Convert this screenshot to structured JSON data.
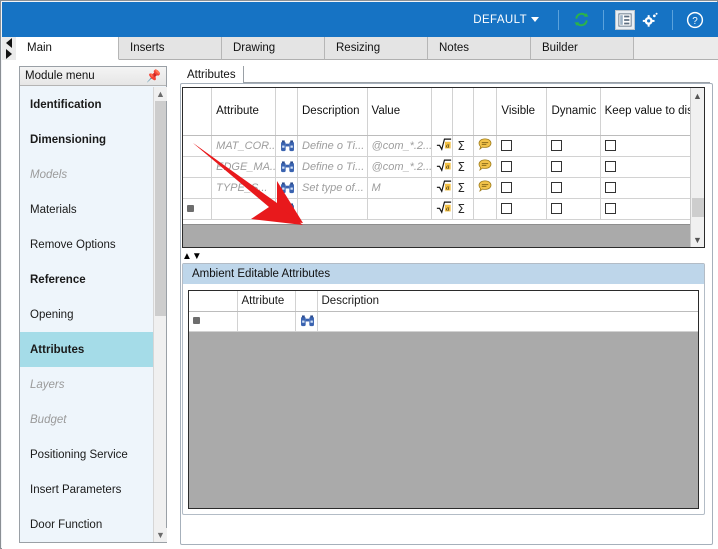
{
  "titlebar": {
    "profile_label": "DEFAULT",
    "caret_icon": "chevron-down-icon",
    "buttons": [
      {
        "name": "refresh-icon",
        "glyph": "↻"
      },
      {
        "name": "list-view-icon",
        "glyph": "▤"
      },
      {
        "name": "settings-gear-icon",
        "glyph": "⚙"
      },
      {
        "name": "help-icon",
        "glyph": "?"
      }
    ]
  },
  "tabs": [
    {
      "label": "Main",
      "active": true
    },
    {
      "label": "Inserts",
      "active": false
    },
    {
      "label": "Drawing",
      "active": false
    },
    {
      "label": "Resizing",
      "active": false
    },
    {
      "label": "Notes",
      "active": false
    },
    {
      "label": "Builder",
      "active": false
    }
  ],
  "sidebar": {
    "title": "Module menu",
    "pin_icon": "pin-icon",
    "items": [
      {
        "label": "Identification",
        "style": "bold"
      },
      {
        "label": "Dimensioning",
        "style": "bold"
      },
      {
        "label": "Models",
        "style": "dim"
      },
      {
        "label": "Materials",
        "style": "normal"
      },
      {
        "label": "Remove Options",
        "style": "normal"
      },
      {
        "label": "Reference",
        "style": "bold"
      },
      {
        "label": "Opening",
        "style": "normal"
      },
      {
        "label": "Attributes",
        "style": "selected"
      },
      {
        "label": "Layers",
        "style": "dim"
      },
      {
        "label": "Budget",
        "style": "dim"
      },
      {
        "label": "Positioning Service",
        "style": "normal"
      },
      {
        "label": "Insert Parameters",
        "style": "normal"
      },
      {
        "label": "Door Function",
        "style": "normal"
      }
    ],
    "scroll_up_icon": "chevron-up-icon",
    "scroll_down_icon": "chevron-down-icon"
  },
  "content": {
    "inner_tabs": [
      {
        "label": "Attributes"
      }
    ],
    "upper_grid": {
      "columns": [
        "",
        "Attribute",
        "",
        "Description",
        "Value",
        "",
        "",
        "",
        "Visible",
        "Dynamic",
        "Keep value to disassociate"
      ],
      "rows": [
        {
          "marker": "",
          "attribute": "MAT_COR...",
          "search_icon": "binoculars-icon",
          "description": "Define o Ti...",
          "value": "@com_*.2...",
          "formula_icon": "sqrt-formula-icon",
          "sum_icon": "Σ",
          "comment_icon": "comment-icon",
          "visible": false,
          "dynamic": false,
          "keep_value": false
        },
        {
          "marker": "",
          "attribute": "EDGE_MA...",
          "search_icon": "binoculars-icon",
          "description": "Define o Ti...",
          "value": "@com_*.2...",
          "formula_icon": "sqrt-formula-icon",
          "sum_icon": "Σ",
          "comment_icon": "comment-icon",
          "visible": false,
          "dynamic": false,
          "keep_value": false
        },
        {
          "marker": "",
          "attribute": "TYPE_S...",
          "search_icon": "binoculars-icon",
          "description": "Set type of...",
          "value": "M",
          "formula_icon": "sqrt-formula-icon",
          "sum_icon": "Σ",
          "comment_icon": "comment-icon",
          "visible": false,
          "dynamic": false,
          "keep_value": false
        },
        {
          "marker": "*",
          "attribute": "",
          "search_icon": "binoculars-icon",
          "description": "",
          "value": "",
          "formula_icon": "sqrt-formula-icon",
          "sum_icon": "Σ",
          "comment_icon": "",
          "visible": false,
          "dynamic": false,
          "keep_value": false
        }
      ],
      "scroll_up_icon": "chevron-up-icon",
      "scroll_down_icon": "chevron-down-icon"
    },
    "splitter": {
      "up_icon": "▲",
      "down_icon": "▼"
    },
    "lower_group": {
      "title": "Ambient Editable Attributes",
      "columns": [
        "",
        "Attribute",
        "",
        "Description"
      ],
      "rows": [
        {
          "marker": "*",
          "attribute": "",
          "search_icon": "binoculars-icon",
          "description": ""
        }
      ]
    }
  },
  "annotation": {
    "arrow_color": "#e8191c",
    "arrow_name": "red-pointer-arrow"
  },
  "colors": {
    "title_bar": "#1673c4",
    "selected_menu": "#a5dce8",
    "group_header": "#bed6ea",
    "sidebar_bg": "#eef5fb",
    "grid_filler": "#aaaaaa"
  }
}
